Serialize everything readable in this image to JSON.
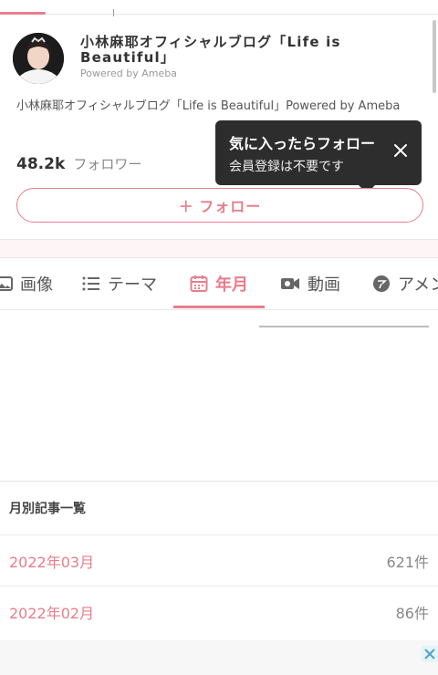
{
  "blog": {
    "title": "小林麻耶オフィシャルブログ「Life is Beautiful」",
    "powered_by": "Powered by Ameba",
    "description": "小林麻耶オフィシャルブログ「Life is Beautiful」Powered by Ameba"
  },
  "followers": {
    "count": "48.2k",
    "label": "フォロワー"
  },
  "tooltip": {
    "title": "気に入ったらフォロー",
    "subtitle": "会員登録は不要です"
  },
  "follow_button": {
    "label": "＋ フォロー"
  },
  "tabs": [
    {
      "label": "画像",
      "icon": "image-icon"
    },
    {
      "label": "テーマ",
      "icon": "list-icon"
    },
    {
      "label": "年月",
      "icon": "calendar-icon",
      "active": true
    },
    {
      "label": "動画",
      "icon": "video-icon"
    },
    {
      "label": "アメンバー",
      "icon": "amember-icon"
    }
  ],
  "monthly": {
    "header": "月別記事一覧",
    "rows": [
      {
        "month": "2022年03月",
        "count": "621件"
      },
      {
        "month": "2022年02月",
        "count": "86件"
      }
    ]
  },
  "colors": {
    "accent": "#e87d8b",
    "tooltip_bg": "#2d2d2d"
  }
}
